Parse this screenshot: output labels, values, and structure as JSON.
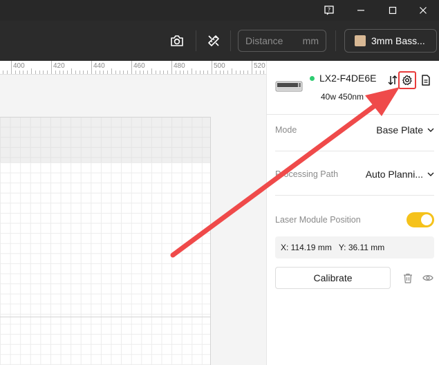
{
  "window": {
    "help_icon": "help-icon",
    "min_icon": "minimize-icon",
    "max_icon": "maximize-icon",
    "close_icon": "close-icon"
  },
  "toolbar": {
    "distance_placeholder": "Distance",
    "distance_unit": "mm",
    "material_label": "3mm Bass...",
    "material_swatch_color": "#d8b894"
  },
  "ruler": {
    "labels": [
      "400",
      "420",
      "440",
      "460",
      "480",
      "500",
      "520"
    ]
  },
  "device": {
    "name": "LX2-F4DE6E",
    "spec": "40w 450nm",
    "status_color": "#2ecc71"
  },
  "settings": {
    "mode_label": "Mode",
    "mode_value": "Base Plate",
    "path_label": "Processing Path",
    "path_value": "Auto Planni...",
    "laser_label": "Laser Module Position",
    "laser_enabled": true,
    "x_text": "X: 114.19 mm",
    "y_text": "Y: 36.11 mm",
    "calibrate_label": "Calibrate"
  },
  "colors": {
    "accent": "#f5c21b",
    "annotation": "#e83b3b"
  }
}
